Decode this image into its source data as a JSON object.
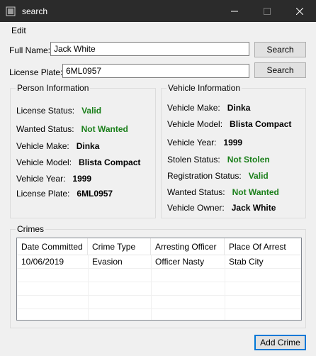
{
  "window": {
    "title": "search"
  },
  "menu": {
    "edit": "Edit"
  },
  "search": {
    "fullname_label": "Full Name:",
    "fullname_value": "Jack White",
    "plate_label": "License Plate:",
    "plate_value": "6ML0957",
    "button_label": "Search"
  },
  "person": {
    "title": "Person Information",
    "rows": [
      {
        "label": "License Status:",
        "value": "Valid"
      },
      {
        "label": "Wanted Status:",
        "value": "Not Wanted"
      },
      {
        "label": "Vehicle Make:",
        "value": "Dinka"
      },
      {
        "label": "Vehicle Model:",
        "value": "Blista Compact"
      },
      {
        "label": "Vehicle Year:",
        "value": "1999"
      },
      {
        "label": "License Plate:",
        "value": "6ML0957"
      }
    ]
  },
  "vehicle": {
    "title": "Vehicle Information",
    "rows": [
      {
        "label": "Vehicle Make:",
        "value": "Dinka"
      },
      {
        "label": "Vehicle Model:",
        "value": "Blista Compact"
      },
      {
        "label": "Vehicle Year:",
        "value": "1999"
      },
      {
        "label": "Stolen Status:",
        "value": "Not Stolen"
      },
      {
        "label": "Registration Status:",
        "value": "Valid"
      },
      {
        "label": "Wanted Status:",
        "value": "Not Wanted"
      },
      {
        "label": "Vehicle Owner:",
        "value": "Jack White"
      }
    ]
  },
  "crimes": {
    "title": "Crimes",
    "columns": [
      "Date Committed",
      "Crime Type",
      "Arresting Officer",
      "Place Of Arrest"
    ],
    "rows": [
      [
        "10/06/2019",
        "Evasion",
        "Officer Nasty",
        "Stab City"
      ]
    ]
  },
  "add_crime_label": "Add Crime",
  "colors": {
    "status_green": "#1a7f1a",
    "titlebar": "#2b2b2b"
  }
}
